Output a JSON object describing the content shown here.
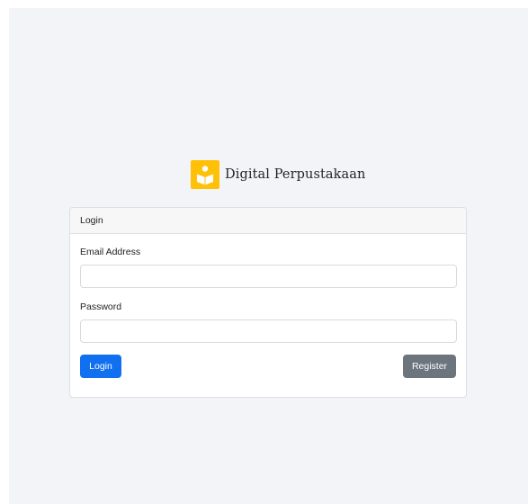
{
  "app": {
    "name": "Digital Perpustakaan",
    "logo_icon": "book-reader-icon"
  },
  "colors": {
    "background": "#f3f4f8",
    "logo_bg": "#ffc107",
    "primary_button": "#1070f0",
    "secondary_button": "#6c757d"
  },
  "login_card": {
    "title": "Login",
    "email": {
      "label": "Email Address",
      "value": "",
      "placeholder": ""
    },
    "password": {
      "label": "Password",
      "value": "",
      "placeholder": ""
    },
    "login_button": "Login",
    "register_button": "Register"
  }
}
